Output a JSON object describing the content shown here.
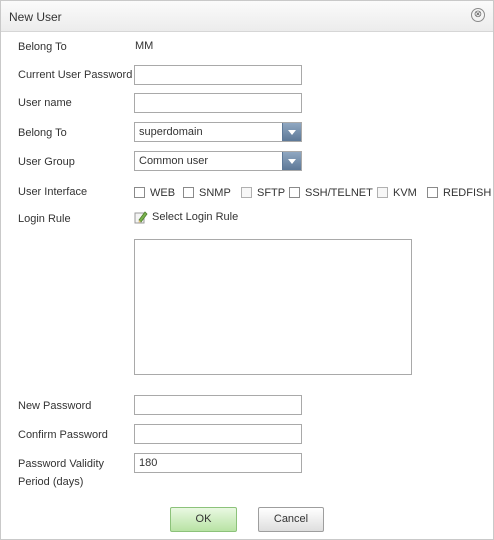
{
  "dialog": {
    "title": "New User",
    "close_glyph": "⊗"
  },
  "fields": {
    "belong_to_label": "Belong To",
    "belong_to_value": "MM",
    "current_password_label": "Current User Password",
    "current_password_value": "",
    "username_label": "User name",
    "username_value": "",
    "belong_to_select_label": "Belong To",
    "belong_to_select_value": "superdomain",
    "user_group_label": "User Group",
    "user_group_value": "Common user",
    "user_interface_label": "User Interface",
    "user_interface_options": [
      {
        "label": "WEB",
        "checked": false
      },
      {
        "label": "SNMP",
        "checked": false
      },
      {
        "label": "SFTP",
        "checked": false
      },
      {
        "label": "SSH/TELNET",
        "checked": false
      },
      {
        "label": "KVM",
        "checked": false
      },
      {
        "label": "REDFISH",
        "checked": false
      }
    ],
    "login_rule_label": "Login Rule",
    "select_login_rule": "Select Login Rule",
    "new_password_label": "New Password",
    "new_password_value": "",
    "confirm_password_label": "Confirm Password",
    "confirm_password_value": "",
    "validity_label_line1": "Password Validity",
    "validity_label_line2": "Period (days)",
    "validity_value": "180"
  },
  "buttons": {
    "ok": "OK",
    "cancel": "Cancel"
  },
  "icons": {
    "close": "close-icon",
    "dropdown": "chevron-down-icon",
    "edit": "pencil-icon"
  },
  "colors": {
    "ok_button": "#b8e3a4",
    "dropdown_arrow": "#5d7897",
    "border": "#a9a9a9"
  }
}
